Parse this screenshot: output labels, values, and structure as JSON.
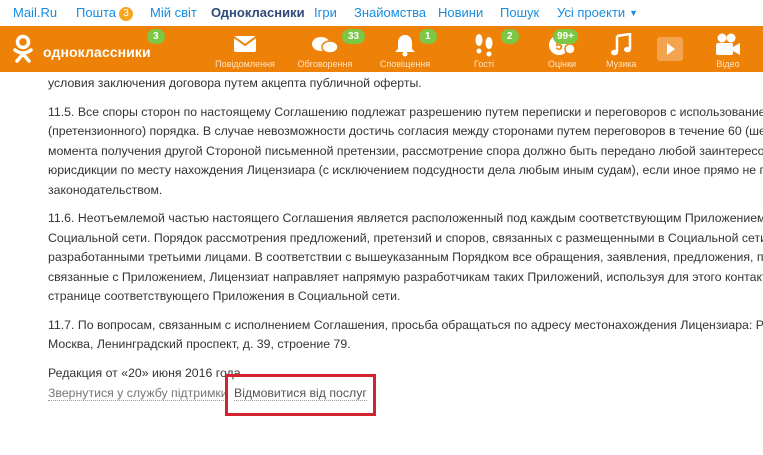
{
  "mailbar": {
    "items": [
      {
        "label": "Mail.Ru"
      },
      {
        "label": "Пошта",
        "badge": "3"
      },
      {
        "label": "Мій світ"
      },
      {
        "label": "Однокласники"
      },
      {
        "label": "Ігри"
      },
      {
        "label": "Знайомства"
      },
      {
        "label": "Новини"
      },
      {
        "label": "Пошук"
      },
      {
        "label": "Усі проекти"
      }
    ]
  },
  "okbar": {
    "logo_text": "одноклассники",
    "logo_badge": "3",
    "nav": [
      {
        "label": "Повідомлення",
        "icon": "envelope-icon"
      },
      {
        "label": "Обговорення",
        "icon": "chat-bubbles-icon",
        "badge": "33"
      },
      {
        "label": "Сповіщення",
        "icon": "bell-icon",
        "badge": "1"
      },
      {
        "label": "Гості",
        "icon": "footprints-icon",
        "badge": "2"
      },
      {
        "label": "Оцінки",
        "icon": "rating-icon",
        "badge": "99+"
      },
      {
        "label": "Музика",
        "icon": "music-note-icon"
      },
      {
        "label": "Відео",
        "icon": "video-camera-icon"
      }
    ],
    "colors": {
      "orange": "#ee8208",
      "badge_green": "#7cc744"
    }
  },
  "document": {
    "lines_top": [
      "условия заключения договора путем акцепта публичной оферты."
    ],
    "p115": [
      "11.5. Все споры сторон по настоящему Соглашению подлежат разрешению путем переписки и переговоров с использованием",
      "(претензионного) порядка. В случае невозможности достичь согласия между сторонами путем переговоров в течение 60 (шест",
      "момента получения другой Стороной письменной претензии, рассмотрение спора должно быть передано любой заинтересо",
      "юрисдикции по месту нахождения Лицензиара (с исключением подсудности дела любым иным судам), если иное прямо не пре",
      "законодательством."
    ],
    "p116": [
      "11.6. Неотъемлемой частью настоящего Соглашения является расположенный под каждым соответствующим Приложением на",
      "Социальной сети. Порядок рассмотрения предложений, претензий и споров, связанных с размещенными в Социальной сети П",
      "разработанными третьими лицами. В соответствии с вышеуказанным Порядком все обращения, заявления, предложения, пре",
      "связанные с Приложением, Лицензиат направляет напрямую разработчикам таких Приложений, используя для этого контактны",
      "странице соответствующего Приложения в Социальной сети."
    ],
    "p117": [
      "11.7. По вопросам, связанным с исполнением Соглашения, просьба обращаться по адресу местонахождения Лицензиара: Рос",
      "Москва, Ленинградский проспект, д. 39, строение 79."
    ],
    "edition": "Редакция от «20» июня 2016 года"
  },
  "footer": {
    "support_link": "Звернутися у службу підтримки",
    "unsubscribe_link": "Відмовитися від послуг",
    "highlight_color": "#d3232f"
  }
}
